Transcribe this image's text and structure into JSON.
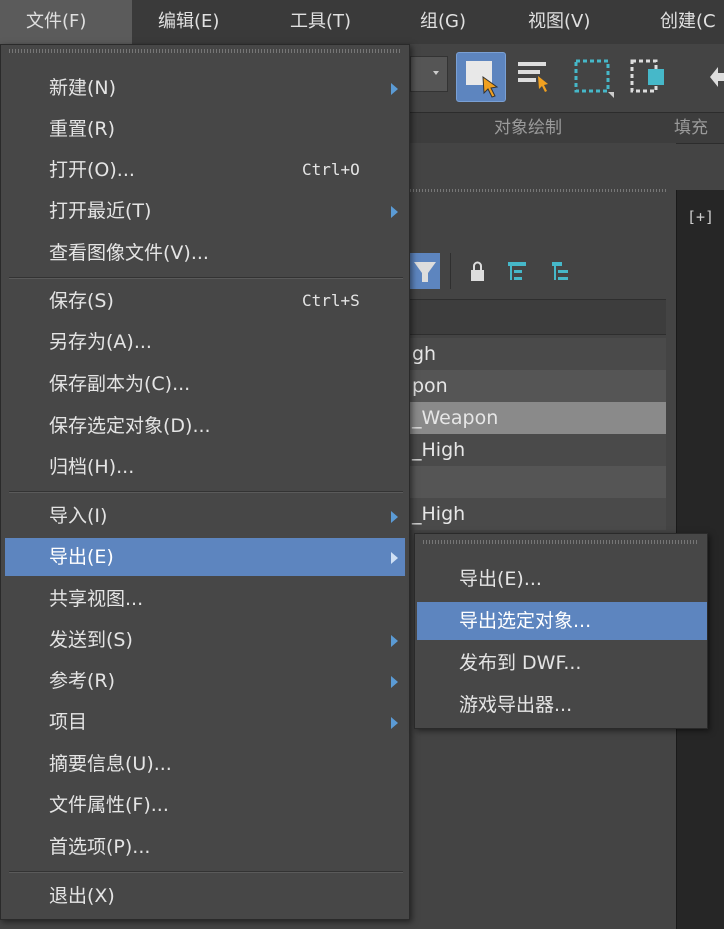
{
  "menubar": {
    "items": [
      {
        "label": "文件(F)"
      },
      {
        "label": "编辑(E)"
      },
      {
        "label": "工具(T)"
      },
      {
        "label": "组(G)"
      },
      {
        "label": "视图(V)"
      },
      {
        "label": "创建(C"
      }
    ]
  },
  "ribbon": {
    "label_1": "对象绘制",
    "label_2": "填充"
  },
  "viewport": {
    "label": "[+]"
  },
  "scene": {
    "rows": [
      "gh",
      "pon",
      "_Weapon",
      "_High",
      "",
      "_High"
    ]
  },
  "file_menu": {
    "items": [
      {
        "label": "新建(N)",
        "shortcut": "",
        "submenu": true
      },
      {
        "label": "重置(R)",
        "shortcut": "",
        "submenu": false
      },
      {
        "label": "打开(O)...",
        "shortcut": "Ctrl+O",
        "submenu": false
      },
      {
        "label": "打开最近(T)",
        "shortcut": "",
        "submenu": true
      },
      {
        "label": "查看图像文件(V)...",
        "shortcut": "",
        "submenu": false
      },
      {
        "label": "保存(S)",
        "shortcut": "Ctrl+S",
        "submenu": false
      },
      {
        "label": "另存为(A)...",
        "shortcut": "",
        "submenu": false
      },
      {
        "label": "保存副本为(C)...",
        "shortcut": "",
        "submenu": false
      },
      {
        "label": "保存选定对象(D)...",
        "shortcut": "",
        "submenu": false
      },
      {
        "label": "归档(H)...",
        "shortcut": "",
        "submenu": false
      },
      {
        "label": "导入(I)",
        "shortcut": "",
        "submenu": true
      },
      {
        "label": "导出(E)",
        "shortcut": "",
        "submenu": true,
        "highlighted": true
      },
      {
        "label": "共享视图...",
        "shortcut": "",
        "submenu": false
      },
      {
        "label": "发送到(S)",
        "shortcut": "",
        "submenu": true
      },
      {
        "label": "参考(R)",
        "shortcut": "",
        "submenu": true
      },
      {
        "label": "项目",
        "shortcut": "",
        "submenu": true
      },
      {
        "label": "摘要信息(U)...",
        "shortcut": "",
        "submenu": false
      },
      {
        "label": "文件属性(F)...",
        "shortcut": "",
        "submenu": false
      },
      {
        "label": "首选项(P)...",
        "shortcut": "",
        "submenu": false
      },
      {
        "label": "退出(X)",
        "shortcut": "",
        "submenu": false
      }
    ]
  },
  "export_submenu": {
    "items": [
      {
        "label": "导出(E)..."
      },
      {
        "label": "导出选定对象...",
        "highlighted": true
      },
      {
        "label": "发布到 DWF..."
      },
      {
        "label": "游戏导出器..."
      }
    ]
  },
  "colors": {
    "highlight": "#5d85bf",
    "menu_bg": "#474747",
    "arrow": "#5b9bd5"
  },
  "icons": [
    "select-object-icon",
    "select-by-name-icon",
    "rectangular-selection-icon",
    "window-crossing-icon",
    "move-icon",
    "filter-icon",
    "lock-icon",
    "hierarchy-icon",
    "hierarchy-alt-icon"
  ]
}
